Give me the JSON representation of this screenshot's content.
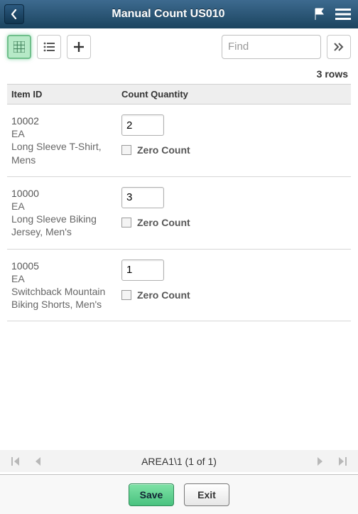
{
  "header": {
    "title": "Manual Count US010"
  },
  "toolbar": {
    "find_placeholder": "Find"
  },
  "grid": {
    "row_summary": "3 rows",
    "columns": {
      "item_id": "Item ID",
      "count_qty": "Count Quantity"
    },
    "zero_label": "Zero Count",
    "rows": [
      {
        "id": "10002",
        "uom": "EA",
        "desc": "Long Sleeve T-Shirt, Mens",
        "qty": "2",
        "zero": false
      },
      {
        "id": "10000",
        "uom": "EA",
        "desc": "Long Sleeve Biking Jersey, Men's",
        "qty": "3",
        "zero": false
      },
      {
        "id": "10005",
        "uom": "EA",
        "desc": "Switchback Mountain Biking Shorts, Men's",
        "qty": "1",
        "zero": false
      }
    ]
  },
  "pager": {
    "text": "AREA1\\1 (1 of 1)"
  },
  "footer": {
    "save": "Save",
    "exit": "Exit"
  }
}
